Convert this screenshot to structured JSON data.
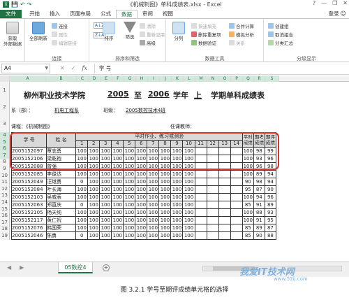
{
  "window": {
    "title": "《机械制图》单科成绩表.xlsx - Excel",
    "controls": [
      "?",
      "—",
      "❐",
      "✕"
    ]
  },
  "quick_access": [
    "💾",
    "↶",
    "↷"
  ],
  "tabs": [
    "文件",
    "开始",
    "插入",
    "页面布局",
    "公式",
    "数据",
    "审阅",
    "视图"
  ],
  "active_tab": "数据",
  "login": "登录",
  "ribbon": {
    "get_external": "获取\n外部数据",
    "refresh_all": "全部刷新",
    "connections": "连接",
    "properties": "属性",
    "edit_links": "编辑链接",
    "sort_az": "A↓Z",
    "sort_za": "Z↓A",
    "sort": "排序",
    "filter": "筛选",
    "clear": "清除",
    "reapply": "重新应用",
    "advanced": "高级",
    "text_to_columns": "分列",
    "flash_fill": "快速填充",
    "remove_dup": "删除重复项",
    "data_validation": "数据验证",
    "consolidate": "合并计算",
    "what_if": "模拟分析",
    "relationships": "关系",
    "group": "创建组",
    "ungroup": "取消组合",
    "subtotal": "分类汇总",
    "group_labels": [
      "连接",
      "排序和筛选",
      "数据工具",
      "分级显示"
    ]
  },
  "formula_bar": {
    "name_box": "A4",
    "formula": "学  号"
  },
  "columns": [
    "A",
    "B",
    "C",
    "D",
    "E",
    "F",
    "G",
    "H",
    "I",
    "J",
    "K",
    "L",
    "M",
    "N",
    "O",
    "P",
    "Q",
    "R",
    "S"
  ],
  "rows": [
    "1",
    "2",
    "3",
    "4",
    "5",
    "6",
    "7",
    "8",
    "9",
    "10",
    "11",
    "12",
    "13",
    "14",
    "15",
    "16",
    "17",
    "18",
    "19"
  ],
  "sheet": {
    "title_school": "柳州职业技术学院",
    "title_year1": "2005",
    "title_to": "至",
    "title_year2": "2006",
    "title_xuenian": "学年",
    "title_term": "上",
    "title_rest": "学期单科成绩表",
    "dept_label": "系（部）：",
    "dept_value": "机电工程系",
    "class_label": "班级：",
    "class_value": "2005数控技术4班",
    "course_label": "课程：《机械制图》",
    "teacher_label": "任课教师：",
    "h_student_id": "学  号",
    "h_name": "姓  名",
    "h_assign": "平时作业、练习或测验",
    "h_assign_nums": [
      "1",
      "2",
      "3",
      "4",
      "5",
      "6",
      "7",
      "8",
      "9",
      "10",
      "11",
      "12",
      "13",
      "14"
    ],
    "h_ps": "平时成绩",
    "h_qk": "期考成绩",
    "h_qp": "期评成绩",
    "students": [
      {
        "id": "2005152097",
        "name": "覃志勇",
        "scores": [
          "100",
          "100",
          "100",
          "100",
          "100",
          "100",
          "100",
          "100",
          "100",
          "100"
        ],
        "ps": "100",
        "qk": "98",
        "qp": "99"
      },
      {
        "id": "2005152106",
        "name": "梁乾袍",
        "scores": [
          "100",
          "100",
          "100",
          "100",
          "100",
          "100",
          "100",
          "100",
          "100",
          "100"
        ],
        "ps": "100",
        "qk": "93",
        "qp": "96"
      },
      {
        "id": "2005152088",
        "name": "曾强",
        "scores": [
          "100",
          "100",
          "100",
          "100",
          "100",
          "100",
          "100",
          "100",
          "100",
          "100"
        ],
        "ps": "100",
        "qk": "96",
        "qp": "98"
      },
      {
        "id": "2005152085",
        "name": "李俊达",
        "scores": [
          "100",
          "100",
          "100",
          "100",
          "100",
          "100",
          "100",
          "100",
          "100",
          "100"
        ],
        "ps": "100",
        "qk": "89",
        "qp": "94"
      },
      {
        "id": "2005152049",
        "name": "汪继勇",
        "scores": [
          "0",
          "100",
          "100",
          "100",
          "100",
          "100",
          "100",
          "100",
          "100",
          "100"
        ],
        "ps": "90",
        "qk": "98",
        "qp": "94"
      },
      {
        "id": "2005152084",
        "name": "叶长海",
        "scores": [
          "100",
          "100",
          "100",
          "100",
          "100",
          "100",
          "100",
          "100",
          "100",
          "100"
        ],
        "ps": "95",
        "qk": "87",
        "qp": "90"
      },
      {
        "id": "2005152103",
        "name": "吴威表",
        "scores": [
          "100",
          "100",
          "100",
          "100",
          "100",
          "100",
          "100",
          "100",
          "100",
          "100"
        ],
        "ps": "100",
        "qk": "94",
        "qp": "96"
      },
      {
        "id": "2005152063",
        "name": "郑直庆",
        "scores": [
          "0",
          "100",
          "100",
          "100",
          "100",
          "100",
          "100",
          "100",
          "100",
          "100"
        ],
        "ps": "85",
        "qk": "91",
        "qp": "89"
      },
      {
        "id": "2005152105",
        "name": "杨天纯",
        "scores": [
          "100",
          "100",
          "100",
          "100",
          "100",
          "100",
          "100",
          "100",
          "100",
          "100"
        ],
        "ps": "100",
        "qk": "88",
        "qp": "93"
      },
      {
        "id": "2005152117",
        "name": "黄仁祝",
        "scores": [
          "100",
          "100",
          "100",
          "100",
          "100",
          "100",
          "100",
          "100",
          "100",
          "100"
        ],
        "ps": "100",
        "qk": "91",
        "qp": "95"
      },
      {
        "id": "2005152076",
        "name": "韩国荣",
        "scores": [
          "100",
          "100",
          "100",
          "100",
          "100",
          "100",
          "100",
          "100",
          "100",
          "100"
        ],
        "ps": "85",
        "qk": "89",
        "qp": "87"
      },
      {
        "id": "2005152046",
        "name": "陈勇",
        "scores": [
          "0",
          "100",
          "100",
          "100",
          "100",
          "100",
          "100",
          "100",
          "100",
          "100"
        ],
        "ps": "85",
        "qk": "90",
        "qp": "88"
      }
    ]
  },
  "sheet_tab": "05数控4",
  "caption": "图 3.2.1  学号至期评成绩单元格的选择",
  "watermark": "我爱IT技术网",
  "watermark_url": "www.52ij.com",
  "colors": {
    "excel_green": "#217346",
    "selection_red": "#d9342b",
    "header_fill": "#d9d9d9"
  }
}
